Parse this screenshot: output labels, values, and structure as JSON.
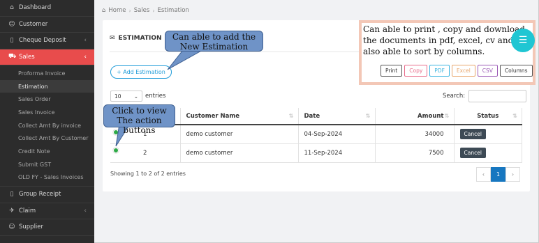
{
  "sidebar": {
    "items": [
      {
        "label": "Dashboard",
        "icon": "dashboard-icon"
      },
      {
        "label": "Customer",
        "icon": "user-icon"
      },
      {
        "label": "Cheque Deposit",
        "icon": "document-icon"
      },
      {
        "label": "Sales",
        "icon": "cart-icon"
      },
      {
        "label": "Group Receipt",
        "icon": "document-icon"
      },
      {
        "label": "Claim",
        "icon": "pin-icon"
      },
      {
        "label": "Supplier",
        "icon": "user-icon"
      }
    ],
    "sales_sub": [
      "Proforma Invoice",
      "Estimation",
      "Sales Order",
      "Sales Invoice",
      "Collect Amt By invoice",
      "Collect Amt By Customer",
      "Credit Note",
      "Submit GST",
      "OLD FY - Sales Invoices"
    ]
  },
  "breadcrumb": {
    "home": "Home",
    "section": "Sales",
    "page": "Estimation"
  },
  "card": {
    "title": "ESTIMATION",
    "add_label": "+ Add Estimation"
  },
  "controls": {
    "length_value": "10",
    "length_suffix": "entries",
    "search_label": "Search:"
  },
  "export": [
    "Print",
    "Copy",
    "PDF",
    "Excel",
    "CSV",
    "Columns"
  ],
  "table": {
    "columns": [
      "#",
      "Customer Name",
      "Date",
      "Amount",
      "Status"
    ],
    "rows": [
      {
        "no": "1",
        "customer": "demo customer",
        "date": "04-Sep-2024",
        "amount": "34000",
        "status": "Cancel"
      },
      {
        "no": "2",
        "customer": "demo customer",
        "date": "11-Sep-2024",
        "amount": "7500",
        "status": "Cancel"
      }
    ]
  },
  "info": "Showing 1 to 2 of 2 entries",
  "pager": {
    "prev": "‹",
    "page": "1",
    "next": "›"
  },
  "annotations": {
    "add": "Can able to add the New Estimation",
    "print": "Can able to print , copy and download the documents in pdf, excel, cv and also able to sort by columns.",
    "view_line1": "Click to view",
    "view_line2": "The action buttons"
  },
  "colors": {
    "sidebar": "#2c2c2c",
    "active": "#e84c4c",
    "primary": "#1777c0",
    "callout": "#6f93c7",
    "fab": "#1fc6d3"
  }
}
